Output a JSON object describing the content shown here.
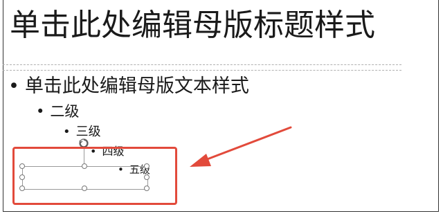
{
  "slide": {
    "title_placeholder": "单击此处编辑母版标题样式",
    "bullets": {
      "level1": "单击此处编辑母版文本样式",
      "level2": "二级",
      "level3": "三级",
      "level4": "四级",
      "level5": "五级",
      "dot": "•"
    }
  },
  "annotation": {
    "color": "#e24a3b"
  }
}
